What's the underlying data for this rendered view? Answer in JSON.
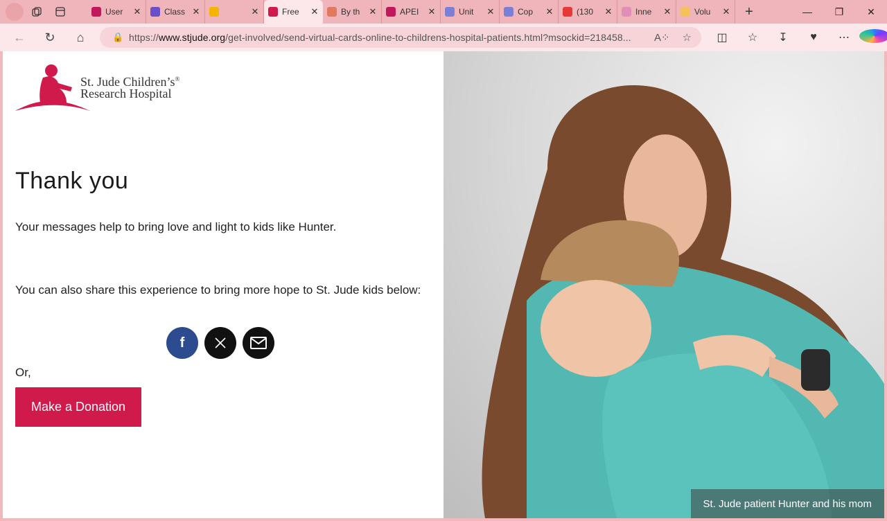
{
  "browser": {
    "tabs": [
      {
        "label": "User",
        "favicon_color": "#c2185b"
      },
      {
        "label": "Class",
        "favicon_color": "#6a4fc9"
      },
      {
        "label": "",
        "favicon_color": "#f4b400"
      },
      {
        "label": "Free",
        "favicon_color": "#d11a4c",
        "active": true
      },
      {
        "label": "By th",
        "favicon_color": "#e07a5f"
      },
      {
        "label": "APEI",
        "favicon_color": "#c2185b"
      },
      {
        "label": "Unit",
        "favicon_color": "#7b7fd6"
      },
      {
        "label": "Cop",
        "favicon_color": "#7b7fd6"
      },
      {
        "label": "(130",
        "favicon_color": "#e53935"
      },
      {
        "label": "Inne",
        "favicon_color": "#e28fb8"
      },
      {
        "label": "Volu",
        "favicon_color": "#f4c15d"
      }
    ],
    "url_prefix": "https://",
    "url_domain": "www.stjude.org",
    "url_path": "/get-involved/send-virtual-cards-online-to-childrens-hospital-patients.html?msockid=218458..."
  },
  "page": {
    "logo_line1": "St. Jude Children’s",
    "logo_line2": "Research Hospital",
    "logo_reg": "®",
    "heading": "Thank you",
    "message": "Your messages help to bring love and light to kids like Hunter.",
    "share_text": "You can also share this experience to bring more hope to St. Jude kids below:",
    "or_text": "Or,",
    "donate_label": "Make a Donation",
    "photo_caption": "St. Jude patient Hunter and his mom",
    "brand_color": "#d11a4c"
  }
}
